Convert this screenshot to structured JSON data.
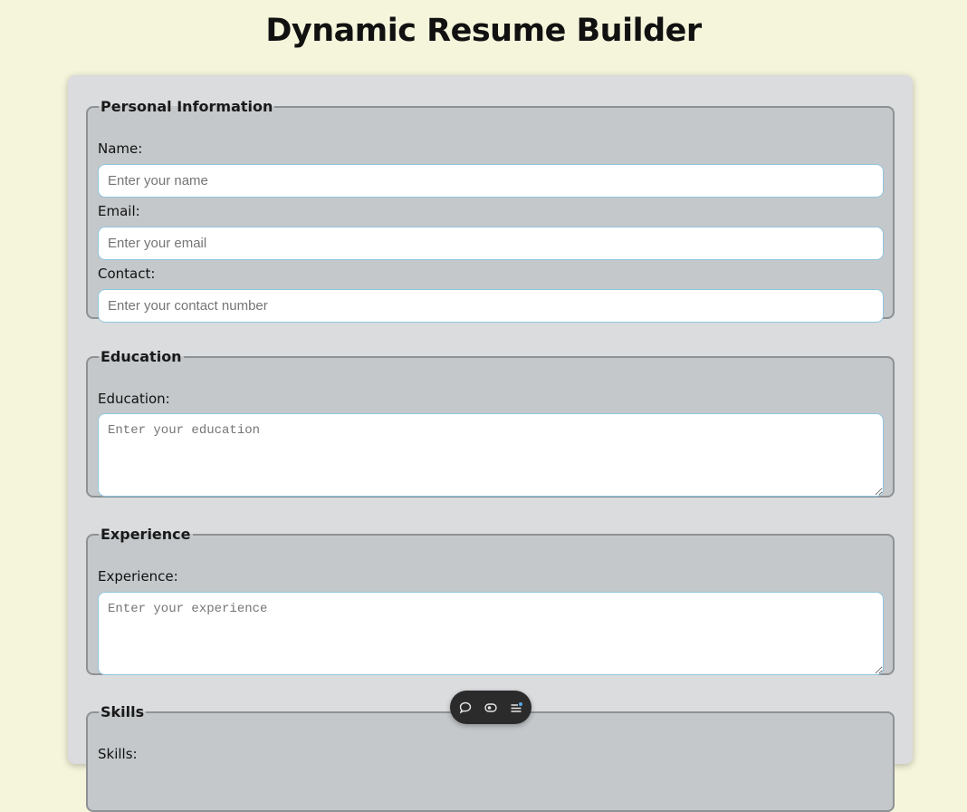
{
  "page": {
    "title": "Dynamic Resume Builder"
  },
  "sections": {
    "personal": {
      "legend": "Personal Information",
      "name_label": "Name:",
      "name_placeholder": "Enter your name",
      "name_value": "",
      "email_label": "Email:",
      "email_placeholder": "Enter your email",
      "email_value": "",
      "contact_label": "Contact:",
      "contact_placeholder": "Enter your contact number",
      "contact_value": ""
    },
    "education": {
      "legend": "Education",
      "label": "Education:",
      "placeholder": "Enter your education",
      "value": ""
    },
    "experience": {
      "legend": "Experience",
      "label": "Experience:",
      "placeholder": "Enter your experience",
      "value": ""
    },
    "skills": {
      "legend": "Skills",
      "label": "Skills:"
    }
  },
  "toolbar": {
    "icons": [
      "comment-icon",
      "eye-toggle-icon",
      "list-menu-icon"
    ]
  },
  "colors": {
    "page_bg": "#f5f5dc",
    "container_bg": "#dadcde",
    "fieldset_bg": "#c4c8ca",
    "input_border": "#8fc6df",
    "toolbar_bg": "#2b2b2b"
  }
}
